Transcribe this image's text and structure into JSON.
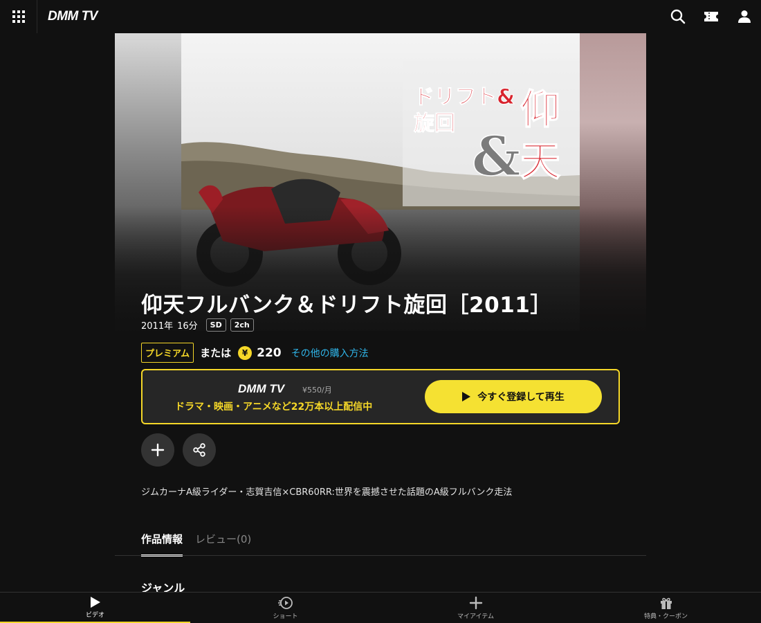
{
  "header": {
    "logo": "DMM TV",
    "icons": [
      "grid-menu-icon",
      "search-icon",
      "ticket-icon",
      "user-icon"
    ]
  },
  "video": {
    "title": "仰天フルバンク＆ドリフト旋回［2011］",
    "year": "2011年",
    "duration": "16分",
    "quality": "SD",
    "audio": "2ch",
    "thumbnail_text": {
      "line1": "ドリフト&",
      "line2": "旋回",
      "big1": "仰",
      "big2": "天",
      "amp": "&"
    }
  },
  "purchase": {
    "premium_label": "プレミアム",
    "or_label": "または",
    "coin_symbol": "¥",
    "price": "220",
    "other_methods_link": "その他の購入方法"
  },
  "promo": {
    "logo": "DMM TV",
    "monthly_price": "¥550/月",
    "tagline": "ドラマ・映画・アニメなど22万本以上配信中",
    "cta_label": "今すぐ登録して再生"
  },
  "description": "ジムカーナA級ライダー・志賀吉信×CBR60RR:世界を震撼させた話題のA級フルバンク走法",
  "tabs": [
    {
      "label": "作品情報",
      "active": true
    },
    {
      "label": "レビュー(0)",
      "active": false
    }
  ],
  "section_heading": "ジャンル",
  "bottom_nav": [
    {
      "label": "ビデオ",
      "icon": "play-icon",
      "active": true
    },
    {
      "label": "ショート",
      "icon": "short-play-icon",
      "active": false
    },
    {
      "label": "マイアイテム",
      "icon": "plus-icon",
      "active": false
    },
    {
      "label": "特典・クーポン",
      "icon": "gift-icon",
      "active": false
    }
  ],
  "colors": {
    "accent": "#f5d728",
    "link": "#2fb4e8",
    "background": "#111111"
  }
}
